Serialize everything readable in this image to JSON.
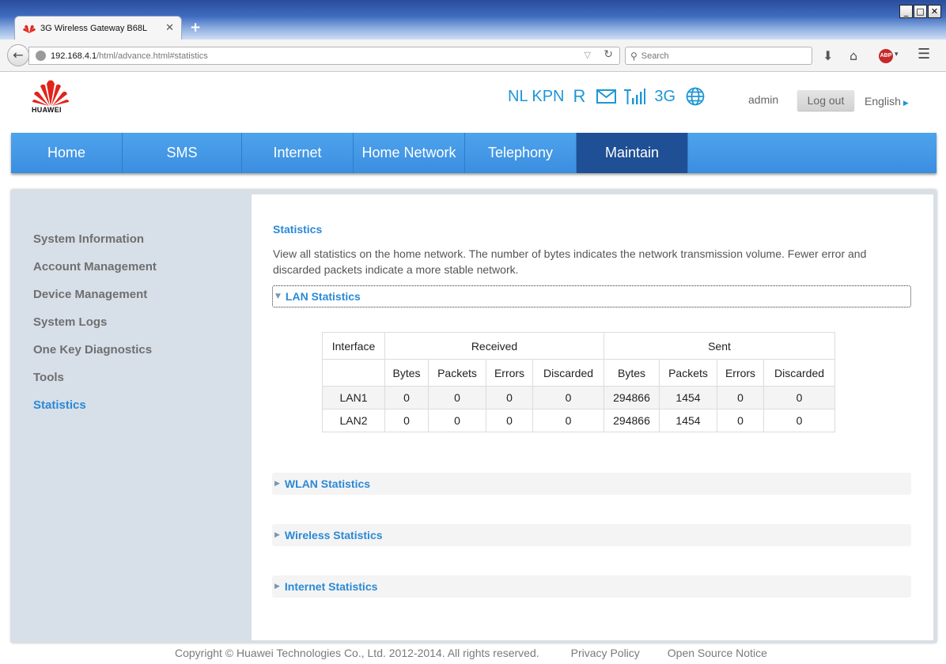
{
  "browser": {
    "tab_title": "3G Wireless Gateway B68L",
    "url_host": "192.168.4.1",
    "url_path": "/html/advance.html#statistics",
    "search_placeholder": "Search"
  },
  "header": {
    "brand": "HUAWEI",
    "operator": "NL KPN",
    "roaming": "R",
    "network_type": "3G",
    "user": "admin",
    "logout_label": "Log out",
    "language": "English"
  },
  "nav": {
    "tabs": [
      {
        "label": "Home"
      },
      {
        "label": "SMS"
      },
      {
        "label": "Internet"
      },
      {
        "label": "Home Network"
      },
      {
        "label": "Telephony"
      },
      {
        "label": "Maintain"
      }
    ],
    "active": "Maintain"
  },
  "sidebar": {
    "items": [
      {
        "label": "System Information"
      },
      {
        "label": "Account Management"
      },
      {
        "label": "Device Management"
      },
      {
        "label": "System Logs"
      },
      {
        "label": "One Key Diagnostics"
      },
      {
        "label": "Tools"
      },
      {
        "label": "Statistics"
      }
    ],
    "active": "Statistics"
  },
  "main": {
    "title": "Statistics",
    "description": "View all statistics on the home network. The number of bytes indicates the network transmission volume. Fewer error and discarded packets indicate a more stable network.",
    "sections": [
      {
        "label": "LAN Statistics"
      },
      {
        "label": "WLAN Statistics"
      },
      {
        "label": "Wireless Statistics"
      },
      {
        "label": "Internet Statistics"
      }
    ],
    "lan_table": {
      "group_headers": {
        "interface": "Interface",
        "received": "Received",
        "sent": "Sent"
      },
      "columns": [
        "Bytes",
        "Packets",
        "Errors",
        "Discarded",
        "Bytes",
        "Packets",
        "Errors",
        "Discarded"
      ],
      "rows": [
        {
          "interface": "LAN1",
          "values": [
            "0",
            "0",
            "0",
            "0",
            "294866",
            "1454",
            "0",
            "0"
          ]
        },
        {
          "interface": "LAN2",
          "values": [
            "0",
            "0",
            "0",
            "0",
            "294866",
            "1454",
            "0",
            "0"
          ]
        }
      ]
    }
  },
  "footer": {
    "copyright": "Copyright © Huawei Technologies Co., Ltd. 2012-2014. All rights reserved.",
    "privacy": "Privacy Policy",
    "open_source": "Open Source Notice"
  },
  "colors": {
    "accent": "#2a89d6",
    "nav_blue": "#3b8ee0",
    "nav_active": "#1f4f94",
    "brand_red": "#e2231a"
  }
}
